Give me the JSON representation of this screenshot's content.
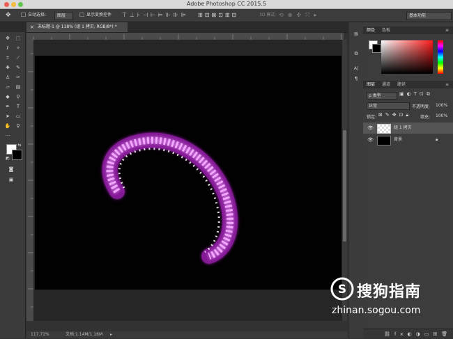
{
  "window": {
    "title": "Adobe Photoshop CC 2015.5"
  },
  "options_bar": {
    "auto_select_label": "自动选择:",
    "auto_select_value": "图层",
    "transform_label": "显示变换控件",
    "mode_label": "3D 模式:",
    "workspace_value": "基本功能"
  },
  "document_tab": {
    "label": "未标题-1 @ 118% (组 1 拷贝, RGB/8*) *"
  },
  "status_bar": {
    "zoom": "117.71%",
    "doc_info": "文档:1.14M/1.16M"
  },
  "color_panel": {
    "tabs": [
      "颜色",
      "色板"
    ]
  },
  "layers_panel": {
    "tabs": [
      "图层",
      "通道",
      "路径"
    ],
    "filter_label": "ρ 类型",
    "blend_mode": "正常",
    "opacity_label": "不透明度:",
    "opacity_value": "100%",
    "lock_label": "锁定:",
    "fill_label": "填充:",
    "fill_value": "100%",
    "layers": [
      {
        "name": "组 1 拷贝",
        "selected": true
      },
      {
        "name": "背景",
        "selected": false
      }
    ]
  },
  "watermark": {
    "brand": "搜狗指南",
    "url": "zhinan.sogou.com"
  },
  "colors": {
    "accent_magenta": "#e040f0",
    "canvas_black": "#010101"
  },
  "view": {
    "zoom_percent": 118
  }
}
